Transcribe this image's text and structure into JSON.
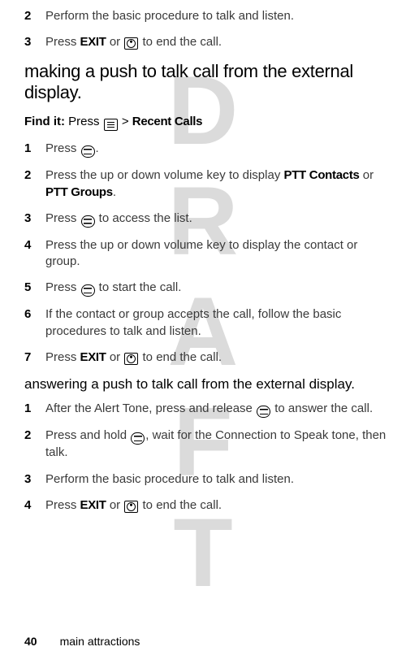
{
  "watermark": "DRAFT",
  "pre_steps": [
    {
      "n": "2",
      "before": "Perform the basic procedure to talk and listen.",
      "bold1": "",
      "mid": "",
      "bold2": "",
      "after": ""
    },
    {
      "n": "3",
      "before": "Press ",
      "bold1": "EXIT",
      "mid": " or ",
      "icon": "end",
      "after": " to end the call."
    }
  ],
  "heading1": "making a push to talk call from the external display.",
  "findit": {
    "label": "Find it:",
    "before": " Press ",
    "icon": "menu",
    "mid": " > ",
    "bold": "Recent Calls"
  },
  "steps1": [
    {
      "n": "1",
      "before": "Press ",
      "icon": "ptt",
      "after": "."
    },
    {
      "n": "2",
      "before": "Press the up or down volume key to display ",
      "bold1": "PTT Contacts",
      "mid": " or ",
      "bold2": "PTT Groups",
      "after": "."
    },
    {
      "n": "3",
      "before": "Press ",
      "icon": "ptt",
      "after": " to access the list."
    },
    {
      "n": "4",
      "before": "Press the up or down volume key to display the contact or group."
    },
    {
      "n": "5",
      "before": "Press ",
      "icon": "ptt",
      "after": " to start the call."
    },
    {
      "n": "6",
      "before": "If the contact or group accepts the call, follow the basic procedures to talk and listen."
    },
    {
      "n": "7",
      "before": "Press ",
      "bold1": "EXIT",
      "mid": " or ",
      "icon": "end",
      "after": " to end the call."
    }
  ],
  "subheading": "answering a push to talk call from the external display.",
  "steps2": [
    {
      "n": "1",
      "before": "After the Alert Tone, press and release ",
      "icon": "ptt",
      "after": " to answer the call."
    },
    {
      "n": "2",
      "before": "Press and hold ",
      "icon": "ptt",
      "after": ", wait for the Connection to Speak tone, then talk."
    },
    {
      "n": "3",
      "before": "Perform the basic procedure to talk and listen."
    },
    {
      "n": "4",
      "before": "Press ",
      "bold1": "EXIT",
      "mid": " or ",
      "icon": "end",
      "after": " to end the call."
    }
  ],
  "footer": {
    "page": "40",
    "section": "main attractions"
  }
}
